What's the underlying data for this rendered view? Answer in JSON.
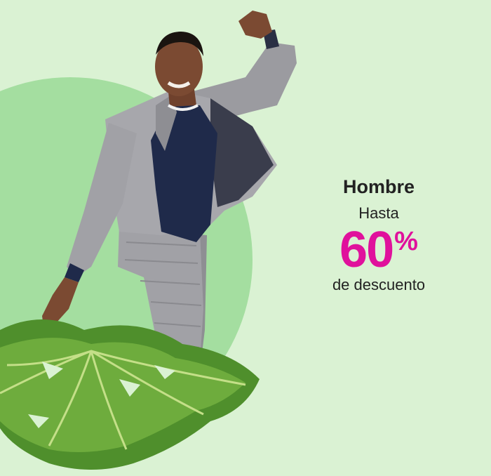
{
  "banner": {
    "title": "Hombre",
    "subtitle": "Hasta",
    "discount_value": "60",
    "discount_symbol": "%",
    "description": "de descuento"
  },
  "colors": {
    "background": "#daf2d3",
    "circle": "#a4dea0",
    "accent": "#e0119c",
    "text": "#222222"
  },
  "images": {
    "model": "man-in-grey-checked-suit",
    "leaf": "monstera-leaf"
  }
}
